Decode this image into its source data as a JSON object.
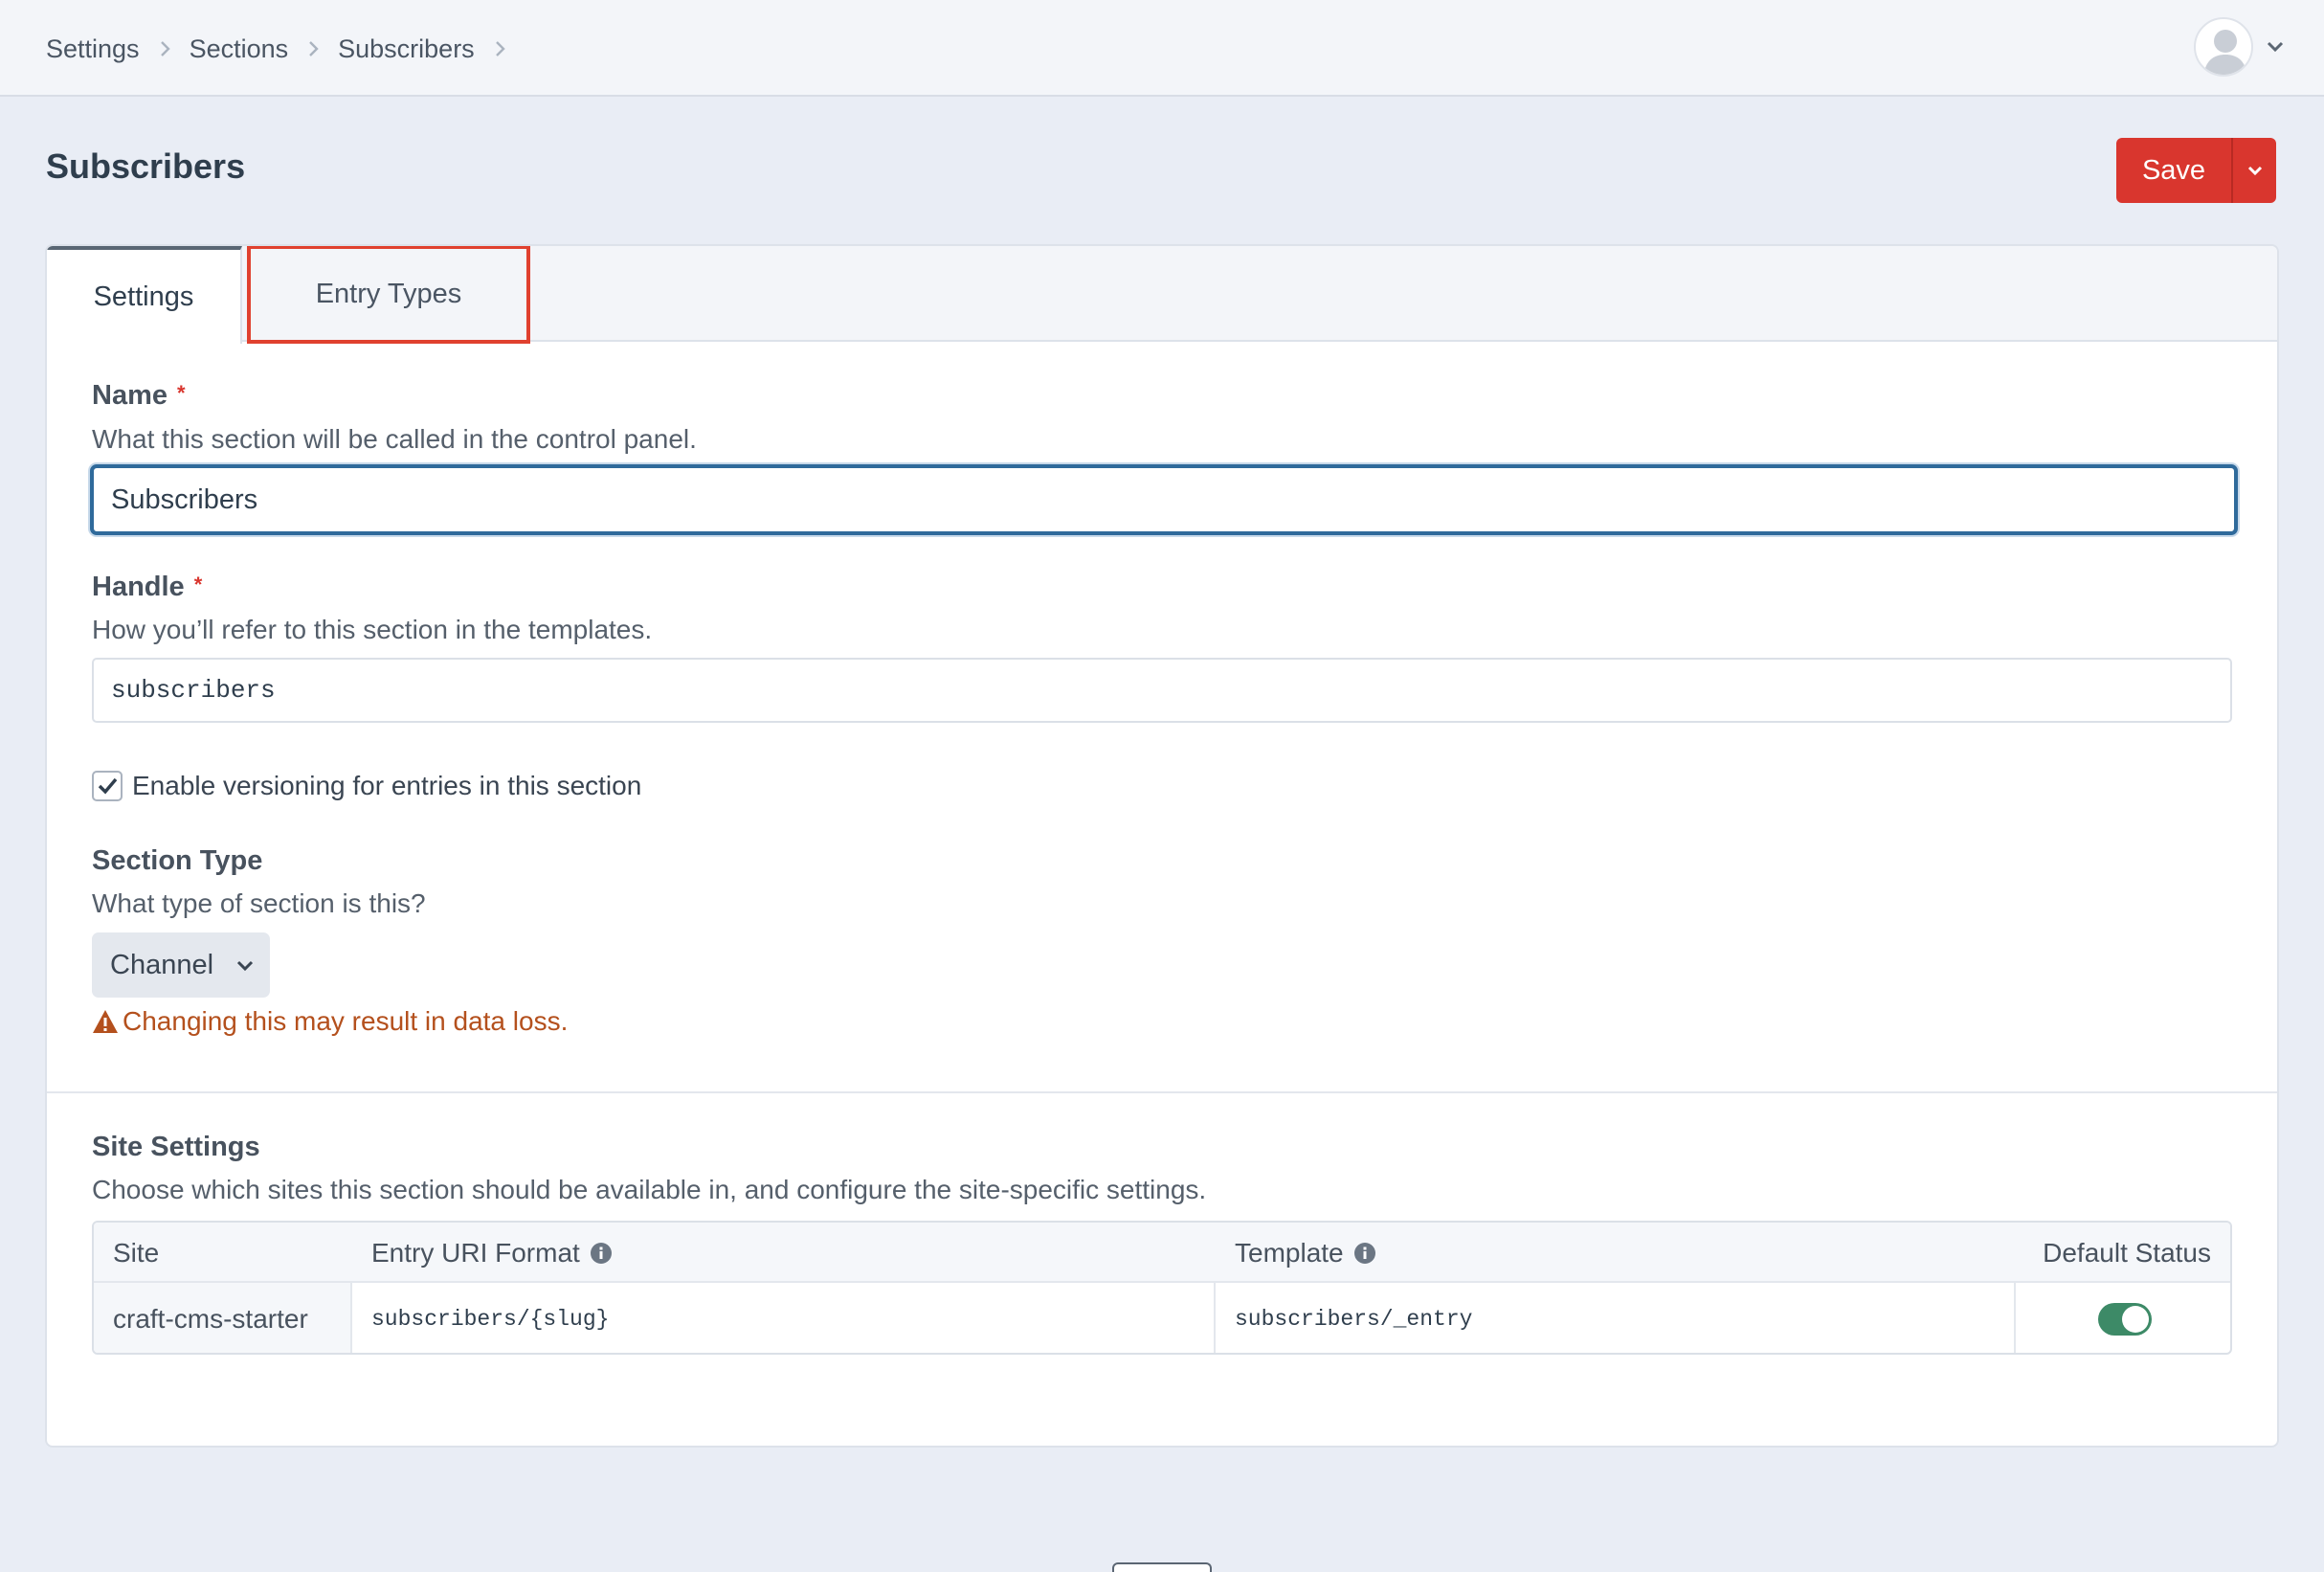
{
  "breadcrumbs": [
    {
      "label": "Settings"
    },
    {
      "label": "Sections"
    },
    {
      "label": "Subscribers"
    }
  ],
  "header": {
    "title": "Subscribers",
    "save_label": "Save"
  },
  "tabs": [
    {
      "label": "Settings",
      "active": true
    },
    {
      "label": "Entry Types",
      "highlighted": true
    }
  ],
  "fields": {
    "name": {
      "label": "Name",
      "help": "What this section will be called in the control panel.",
      "value": "Subscribers",
      "required_mark": "*"
    },
    "handle": {
      "label": "Handle",
      "help": "How you’ll refer to this section in the templates.",
      "value": "subscribers",
      "required_mark": "*"
    },
    "versioning": {
      "label": "Enable versioning for entries in this section",
      "checked": true
    },
    "section_type": {
      "label": "Section Type",
      "help": "What type of section is this?",
      "value": "Channel",
      "warning": "Changing this may result in data loss."
    }
  },
  "site_settings": {
    "label": "Site Settings",
    "help": "Choose which sites this section should be available in, and configure the site-specific settings.",
    "columns": [
      "Site",
      "Entry URI Format",
      "Template",
      "Default Status"
    ],
    "rows": [
      {
        "site": "craft-cms-starter",
        "uri_format": "subscribers/{slug}",
        "template": "subscribers/_entry",
        "default_status": true
      }
    ]
  },
  "colors": {
    "accent_red": "#d9362e",
    "focus_blue": "#2f6a9b",
    "toggle_green": "#3d8a67",
    "warning_orange": "#b4501d",
    "highlight_box": "#e0412f"
  },
  "icons": {
    "breadcrumb_separator": "chevron-right-icon",
    "user_menu": "user-avatar-icon",
    "info": "info-icon",
    "warning": "warning-triangle-icon"
  }
}
